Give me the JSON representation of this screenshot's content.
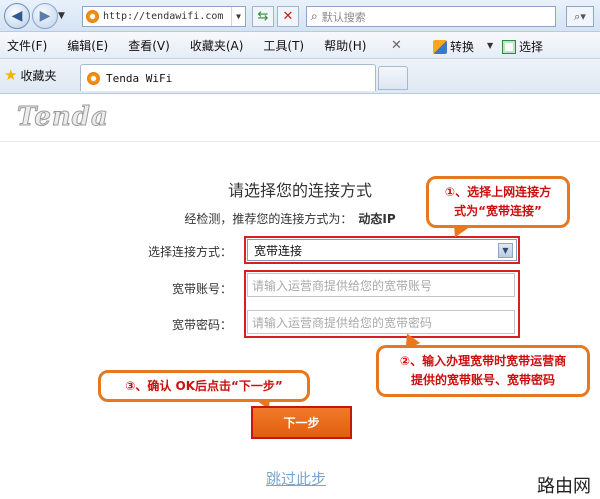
{
  "browser": {
    "url": "http://tendawifi.com",
    "search_placeholder": "默认搜索",
    "menu": [
      "文件(F)",
      "编辑(E)",
      "查看(V)",
      "收藏夹(A)",
      "工具(T)",
      "帮助(H)"
    ],
    "toolbar_translate": "转换",
    "toolbar_select": "选择",
    "favorites_label": "收藏夹",
    "tab_title": "Tenda WiFi"
  },
  "page": {
    "logo": "Tenda",
    "title": "请选择您的连接方式",
    "detect_text": "经检测，推荐您的连接方式为：",
    "detect_value": "动态IP",
    "field_connection_label": "选择连接方式：",
    "field_connection_value": "宽带连接",
    "field_account_label": "宽带账号：",
    "field_account_placeholder": "请输入运营商提供给您的宽带账号",
    "field_password_label": "宽带密码：",
    "field_password_placeholder": "请输入运营商提供给您的宽带密码",
    "next_button": "下一步",
    "skip_link": "跳过此步"
  },
  "annotations": {
    "step1_line1": "①、选择上网连接方",
    "step1_line2": "式为“宽带连接”",
    "step2_line1": "②、输入办理宽带时宽带运营商",
    "step2_line2": "提供的宽带账号、宽带密码",
    "step3": "③、确认 OK后点击“下一步”"
  },
  "watermark": "路由网",
  "colors": {
    "accent_orange": "#e8781e",
    "highlight_red": "#d62020",
    "button": "#e86a1c",
    "link": "#7aa5cf"
  }
}
